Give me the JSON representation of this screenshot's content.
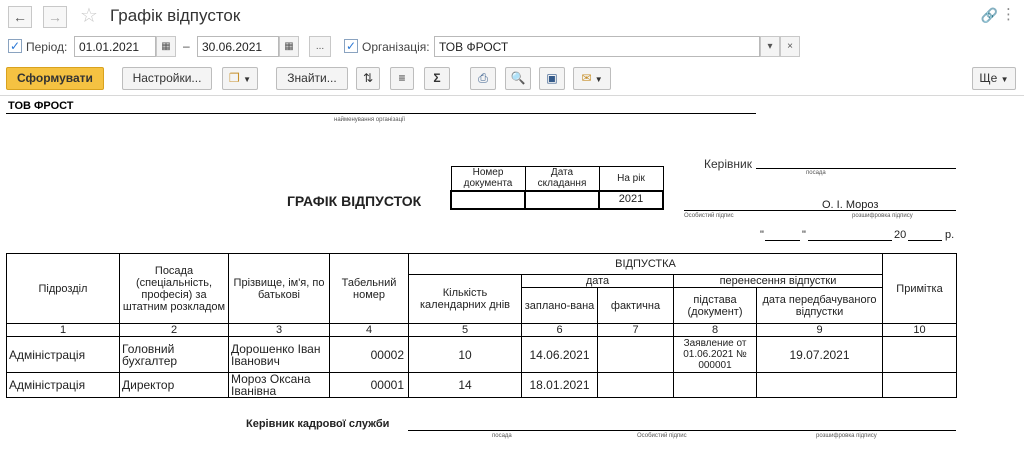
{
  "window": {
    "title": "Графік відпусток"
  },
  "filters": {
    "period_label": "Період:",
    "date_from": "01.01.2021",
    "date_sep": "–",
    "date_to": "30.06.2021",
    "ellipsis": "...",
    "org_label": "Організація:",
    "org_value": "ТОВ ФРОСТ",
    "period_checked": true,
    "org_checked": true
  },
  "toolbar": {
    "generate": "Сформувати",
    "settings": "Настройки...",
    "find": "Знайти...",
    "more": "Ще"
  },
  "report": {
    "org_name": "ТОВ ФРОСТ",
    "org_caption": "найменування організації",
    "title": "ГРАФІК ВІДПУСТОК",
    "doc_headers": {
      "doc_number": "Номер документа",
      "doc_date": "Дата складання",
      "year": "На рік"
    },
    "doc_values": {
      "doc_number": "",
      "doc_date": "",
      "year": "2021"
    },
    "head_label": "Керівник",
    "position_caption": "посада",
    "head_name": "О. І. Мороз",
    "personal_sign_caption": "Особистий підпис",
    "decode_caption": "розшифровка підпису",
    "date_quote_open": "\"",
    "date_quote_close": "\"",
    "year_prefix": "20",
    "year_suffix": "р.",
    "columns": {
      "department": "Підрозділ",
      "position": "Посада (спеціальність, професія) за штатним розкладом",
      "name": "Прізвище, ім'я, по батькові",
      "tab_number": "Табельний номер",
      "vacation": "ВІДПУСТКА",
      "days": "Кількість календарних днів",
      "date": "дата",
      "planned": "заплано-вана",
      "actual": "фактична",
      "transfer": "перенесення відпустки",
      "basis": "підстава (документ)",
      "expected_date": "дата передбачуваного відпустки",
      "note": "Примітка"
    },
    "column_numbers": [
      "1",
      "2",
      "3",
      "4",
      "5",
      "6",
      "7",
      "8",
      "9",
      "10"
    ],
    "rows": [
      {
        "department": "Адміністрація",
        "position": "Головний бухгалтер",
        "name": "Дорошенко Іван Іванович",
        "tab_number": "00002",
        "days": "10",
        "planned": "14.06.2021",
        "actual": "",
        "basis": "Заявление от 01.06.2021 № 000001",
        "expected_date": "19.07.2021",
        "note": ""
      },
      {
        "department": "Адміністрація",
        "position": "Директор",
        "name": "Мороз Оксана Іванівна",
        "tab_number": "00001",
        "days": "14",
        "planned": "18.01.2021",
        "actual": "",
        "basis": "",
        "expected_date": "",
        "note": ""
      }
    ],
    "hr_head_label": "Керівник кадрової служби",
    "footer_position_caption": "посада",
    "footer_sign_caption": "Особистий підпис",
    "footer_decode_caption": "розшифровка підпису"
  }
}
